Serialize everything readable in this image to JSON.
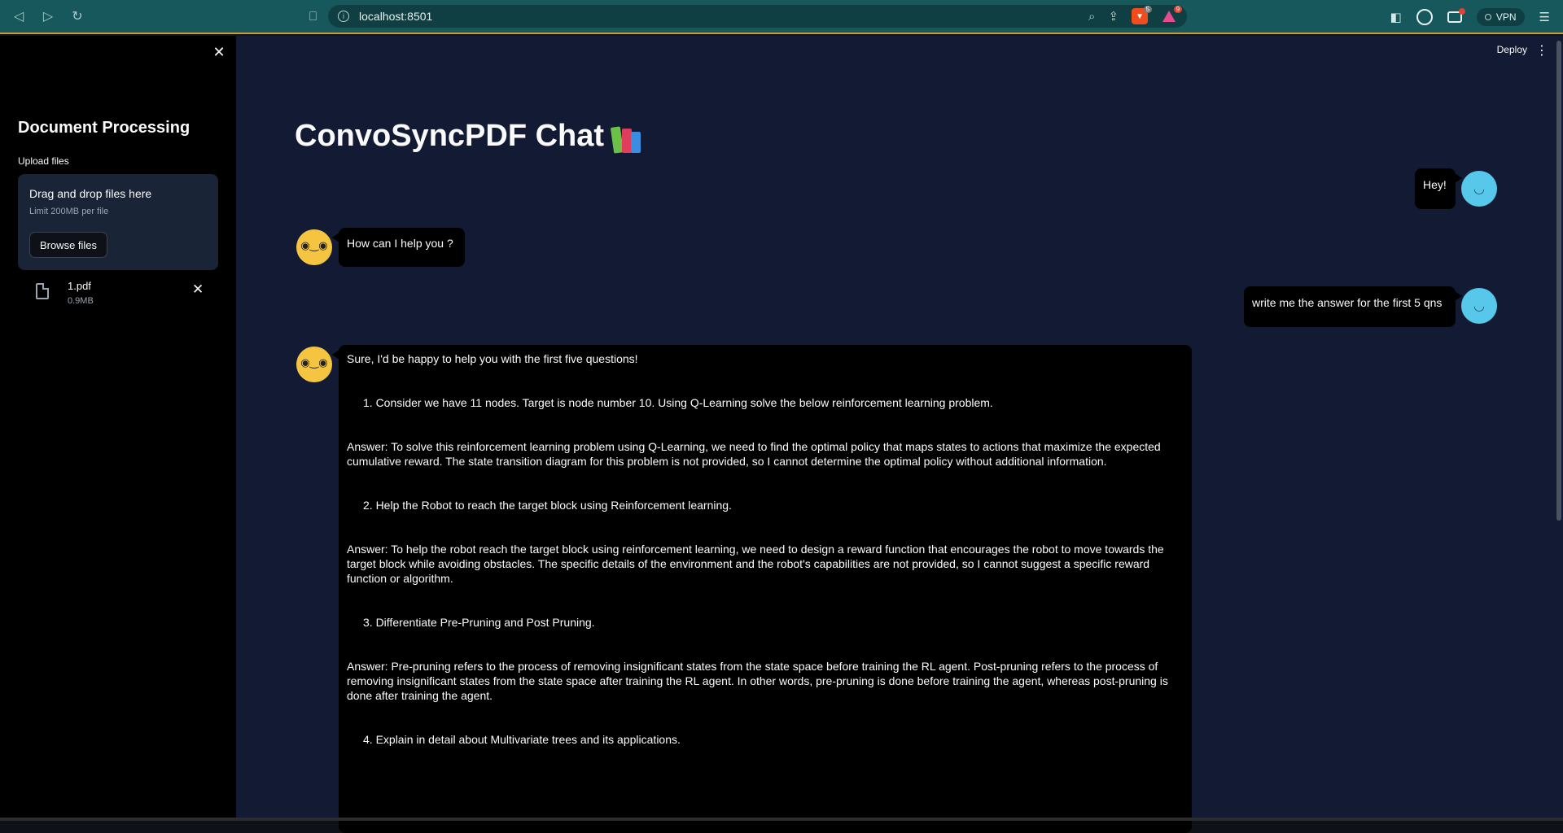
{
  "browser": {
    "url": "localhost:8501",
    "brave_badge": "5",
    "rewards_badge": "9",
    "vpn_label": "VPN"
  },
  "sidebar": {
    "close_icon": "close-icon",
    "title": "Document Processing",
    "upload_label": "Upload files",
    "dropzone_title": "Drag and drop files here",
    "dropzone_limit": "Limit 200MB per file",
    "browse_label": "Browse files",
    "files": [
      {
        "name": "1.pdf",
        "size": "0.9MB"
      }
    ]
  },
  "header": {
    "deploy_label": "Deploy"
  },
  "main": {
    "title": "ConvoSyncPDF Chat"
  },
  "messages": [
    {
      "role": "user",
      "text": "Hey!"
    },
    {
      "role": "assistant",
      "text": "How can I help you ?"
    },
    {
      "role": "user",
      "text": "write me the answer for the first 5 qns"
    },
    {
      "role": "assistant",
      "intro": "Sure, I'd be happy to help you with the first five questions!",
      "items": [
        {
          "question": "1. Consider we have 11 nodes. Target is node number 10. Using Q-Learning solve the below reinforcement learning problem.",
          "answer": "Answer: To solve this reinforcement learning problem using Q-Learning, we need to find the optimal policy that maps states to actions that maximize the expected cumulative reward. The state transition diagram for this problem is not provided, so I cannot determine the optimal policy without additional information."
        },
        {
          "question": "2. Help the Robot to reach the target block using Reinforcement learning.",
          "answer": "Answer: To help the robot reach the target block using reinforcement learning, we need to design a reward function that encourages the robot to move towards the target block while avoiding obstacles. The specific details of the environment and the robot's capabilities are not provided, so I cannot suggest a specific reward function or algorithm."
        },
        {
          "question": "3. Differentiate Pre-Pruning and Post Pruning.",
          "answer": "Answer: Pre-pruning refers to the process of removing insignificant states from the state space before training the RL agent. Post-pruning refers to the process of removing insignificant states from the state space after training the RL agent. In other words, pre-pruning is done before training the agent, whereas post-pruning is done after training the agent."
        },
        {
          "question": "4. Explain in detail about Multivariate trees and its applications.",
          "answer": ""
        }
      ]
    }
  ]
}
